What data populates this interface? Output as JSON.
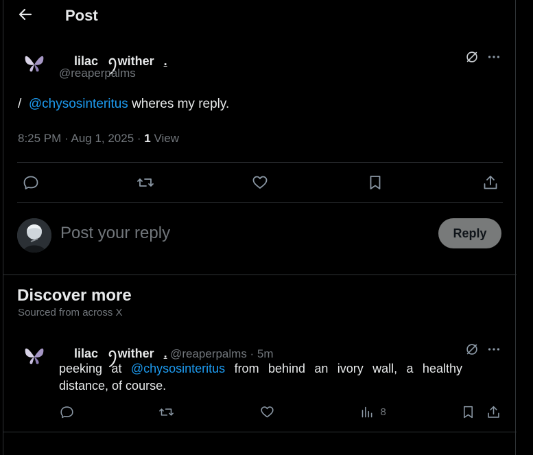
{
  "header": {
    "title": "Post"
  },
  "post": {
    "display_name": "lilac",
    "display_name_symbol": "ꪆ",
    "display_name_rest": "wither",
    "display_name_suffix": ".",
    "handle": "@reaperpalms",
    "text_prefix": "/",
    "mention": "@chysosinteritus",
    "text_rest": "wheres my reply.",
    "timestamp": "8:25 PM · Aug 1, 2025 · ",
    "view_count": "1",
    "view_label": "View"
  },
  "compose": {
    "placeholder": "Post your reply",
    "reply_label": "Reply"
  },
  "discover": {
    "title": "Discover more",
    "subtitle": "Sourced from across X"
  },
  "feed_post": {
    "display_name": "lilac",
    "display_name_symbol": "ꪆ",
    "display_name_rest": "wither",
    "display_name_suffix": ".",
    "handle_time": "@reaperpalms · 5m",
    "text_prefix": "peeking at",
    "mention": "@chysosinteritus",
    "text_rest": "from behind an ivory wall, a healthy distance, of course.",
    "views": "8"
  }
}
